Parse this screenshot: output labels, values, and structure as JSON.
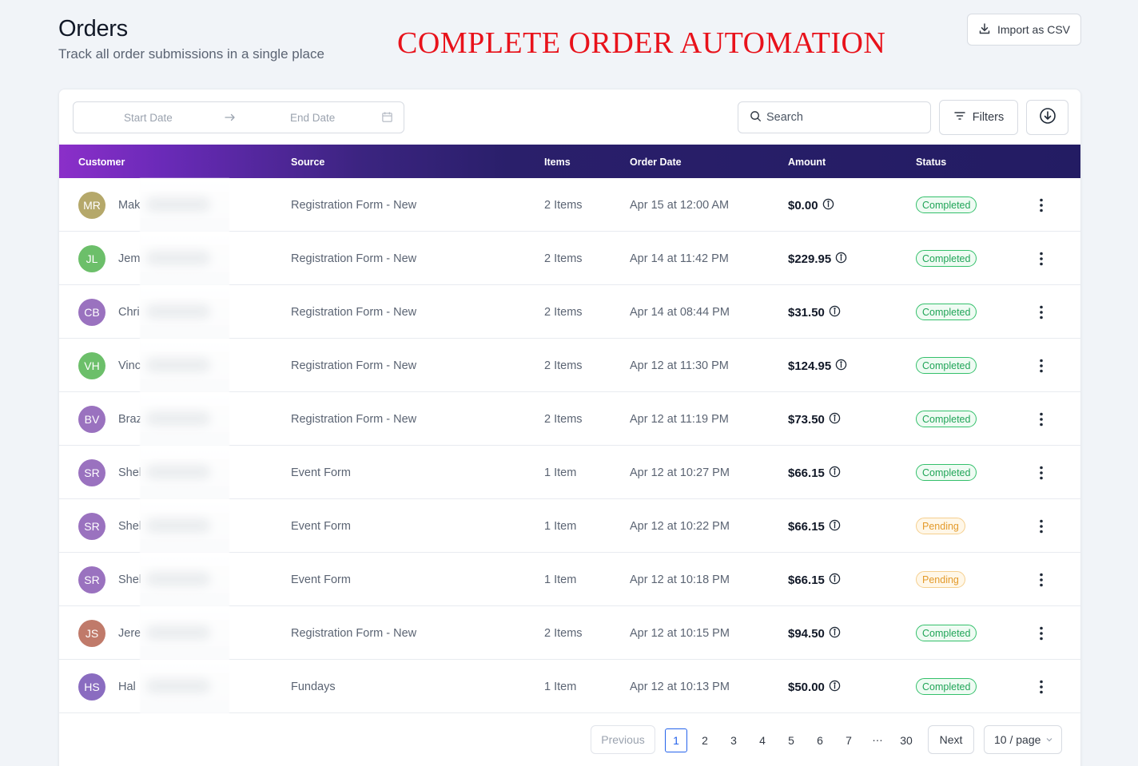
{
  "header": {
    "title": "Orders",
    "subtitle": "Track all order submissions in a single place",
    "banner": "COMPLETE ORDER AUTOMATION",
    "import_label": "Import as CSV"
  },
  "toolbar": {
    "start_placeholder": "Start Date",
    "end_placeholder": "End Date",
    "search_placeholder": "Search",
    "filters_label": "Filters"
  },
  "table": {
    "columns": [
      "Customer",
      "Source",
      "Items",
      "Order Date",
      "Amount",
      "Status"
    ],
    "rows": [
      {
        "initials": "MR",
        "avatar_color": "#b5a86a",
        "name": "Mak",
        "source": "Registration Form - New",
        "items": "2 Items",
        "date": "Apr 15 at 12:00 AM",
        "amount": "$0.00",
        "status": "Completed"
      },
      {
        "initials": "JL",
        "avatar_color": "#6cbf6a",
        "name": "Jem",
        "source": "Registration Form - New",
        "items": "2 Items",
        "date": "Apr 14 at 11:42 PM",
        "amount": "$229.95",
        "status": "Completed"
      },
      {
        "initials": "CB",
        "avatar_color": "#9a72bf",
        "name": "Chri",
        "source": "Registration Form - New",
        "items": "2 Items",
        "date": "Apr 14 at 08:44 PM",
        "amount": "$31.50",
        "status": "Completed"
      },
      {
        "initials": "VH",
        "avatar_color": "#6cbf6a",
        "name": "Vinc",
        "source": "Registration Form - New",
        "items": "2 Items",
        "date": "Apr 12 at 11:30 PM",
        "amount": "$124.95",
        "status": "Completed"
      },
      {
        "initials": "BV",
        "avatar_color": "#9a72bf",
        "name": "Braz",
        "source": "Registration Form - New",
        "items": "2 Items",
        "date": "Apr 12 at 11:19 PM",
        "amount": "$73.50",
        "status": "Completed"
      },
      {
        "initials": "SR",
        "avatar_color": "#9a72bf",
        "name": "Shel",
        "source": "Event Form",
        "items": "1 Item",
        "date": "Apr 12 at 10:27 PM",
        "amount": "$66.15",
        "status": "Completed"
      },
      {
        "initials": "SR",
        "avatar_color": "#9a72bf",
        "name": "Shel",
        "source": "Event Form",
        "items": "1 Item",
        "date": "Apr 12 at 10:22 PM",
        "amount": "$66.15",
        "status": "Pending"
      },
      {
        "initials": "SR",
        "avatar_color": "#9a72bf",
        "name": "Shel",
        "source": "Event Form",
        "items": "1 Item",
        "date": "Apr 12 at 10:18 PM",
        "amount": "$66.15",
        "status": "Pending"
      },
      {
        "initials": "JS",
        "avatar_color": "#c07a6a",
        "name": "Jere",
        "source": "Registration Form - New",
        "items": "2 Items",
        "date": "Apr 12 at 10:15 PM",
        "amount": "$94.50",
        "status": "Completed"
      },
      {
        "initials": "HS",
        "avatar_color": "#8a6cc0",
        "name": "Hal",
        "source": "Fundays",
        "items": "1 Item",
        "date": "Apr 12 at 10:13 PM",
        "amount": "$50.00",
        "status": "Completed"
      }
    ]
  },
  "pagination": {
    "previous_label": "Previous",
    "next_label": "Next",
    "pages": [
      "1",
      "2",
      "3",
      "4",
      "5",
      "6",
      "7",
      "…",
      "30"
    ],
    "current_page": "1",
    "page_size_label": "10 / page"
  },
  "colors": {
    "banner": "#e8121b",
    "header_gradient_start": "#8b2fc9",
    "header_gradient_end": "#231c63",
    "completed": "#21a558",
    "pending": "#e39a2b",
    "active_page": "#2563eb"
  }
}
